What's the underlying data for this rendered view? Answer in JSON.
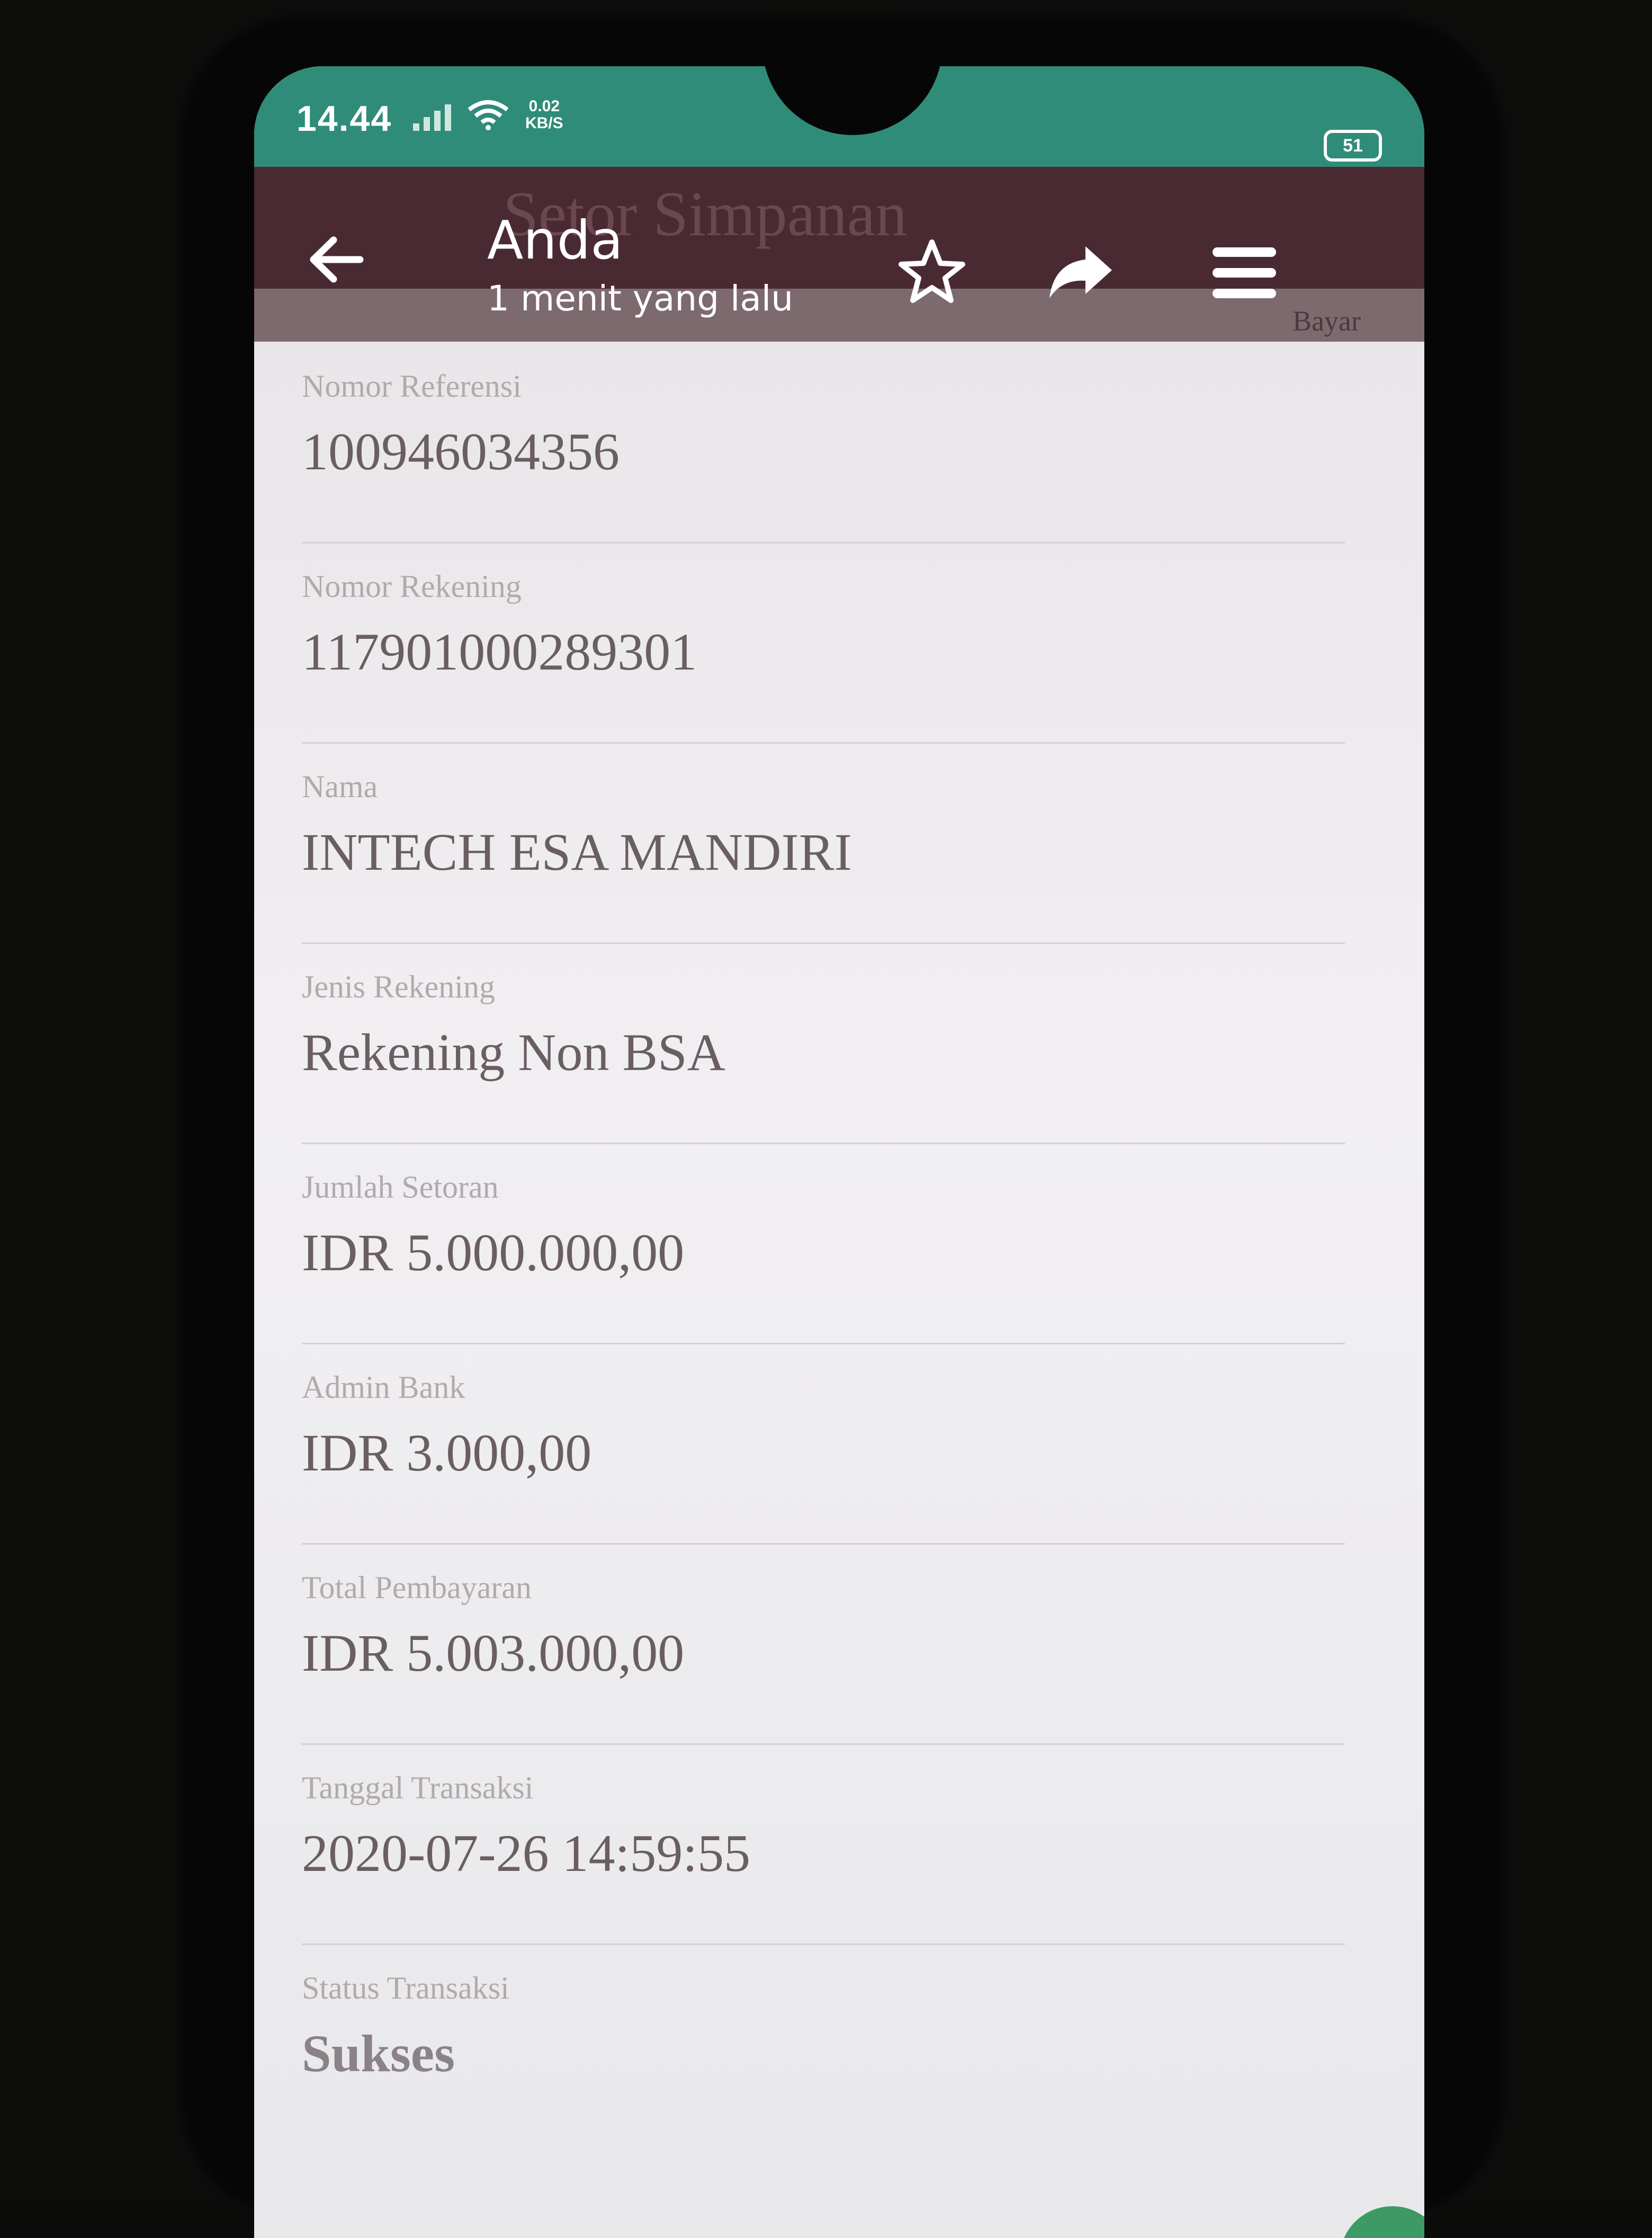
{
  "status_bar": {
    "time": "14.44",
    "speed_value": "0.02",
    "speed_unit": "KB/S",
    "battery": "51"
  },
  "header": {
    "title": "Anda",
    "subtitle": "1 menit yang lalu",
    "background_title": "Setor Simpanan",
    "background_step": "Bayar"
  },
  "transaction": {
    "fields": [
      {
        "label": "Nomor Referensi",
        "value": "100946034356"
      },
      {
        "label": "Nomor Rekening",
        "value": "117901000289301"
      },
      {
        "label": "Nama",
        "value": "INTECH ESA MANDIRI"
      },
      {
        "label": "Jenis Rekening",
        "value": "Rekening Non BSA"
      },
      {
        "label": "Jumlah Setoran",
        "value": "IDR 5.000.000,00"
      },
      {
        "label": "Admin Bank",
        "value": "IDR 3.000,00"
      },
      {
        "label": "Total Pembayaran",
        "value": "IDR 5.003.000,00"
      },
      {
        "label": "Tanggal Transaksi",
        "value": "2020-07-26 14:59:55"
      },
      {
        "label": "Status Transaksi",
        "value": "Sukses"
      }
    ]
  },
  "colors": {
    "status_bar": "#2f8c78",
    "app_bar": "#4a2a32",
    "label": "#b2a9ad",
    "value": "#6a5e61"
  },
  "icons": {
    "back": "arrow-left",
    "star": "star-outline",
    "share": "share-arrow",
    "menu": "hamburger"
  }
}
